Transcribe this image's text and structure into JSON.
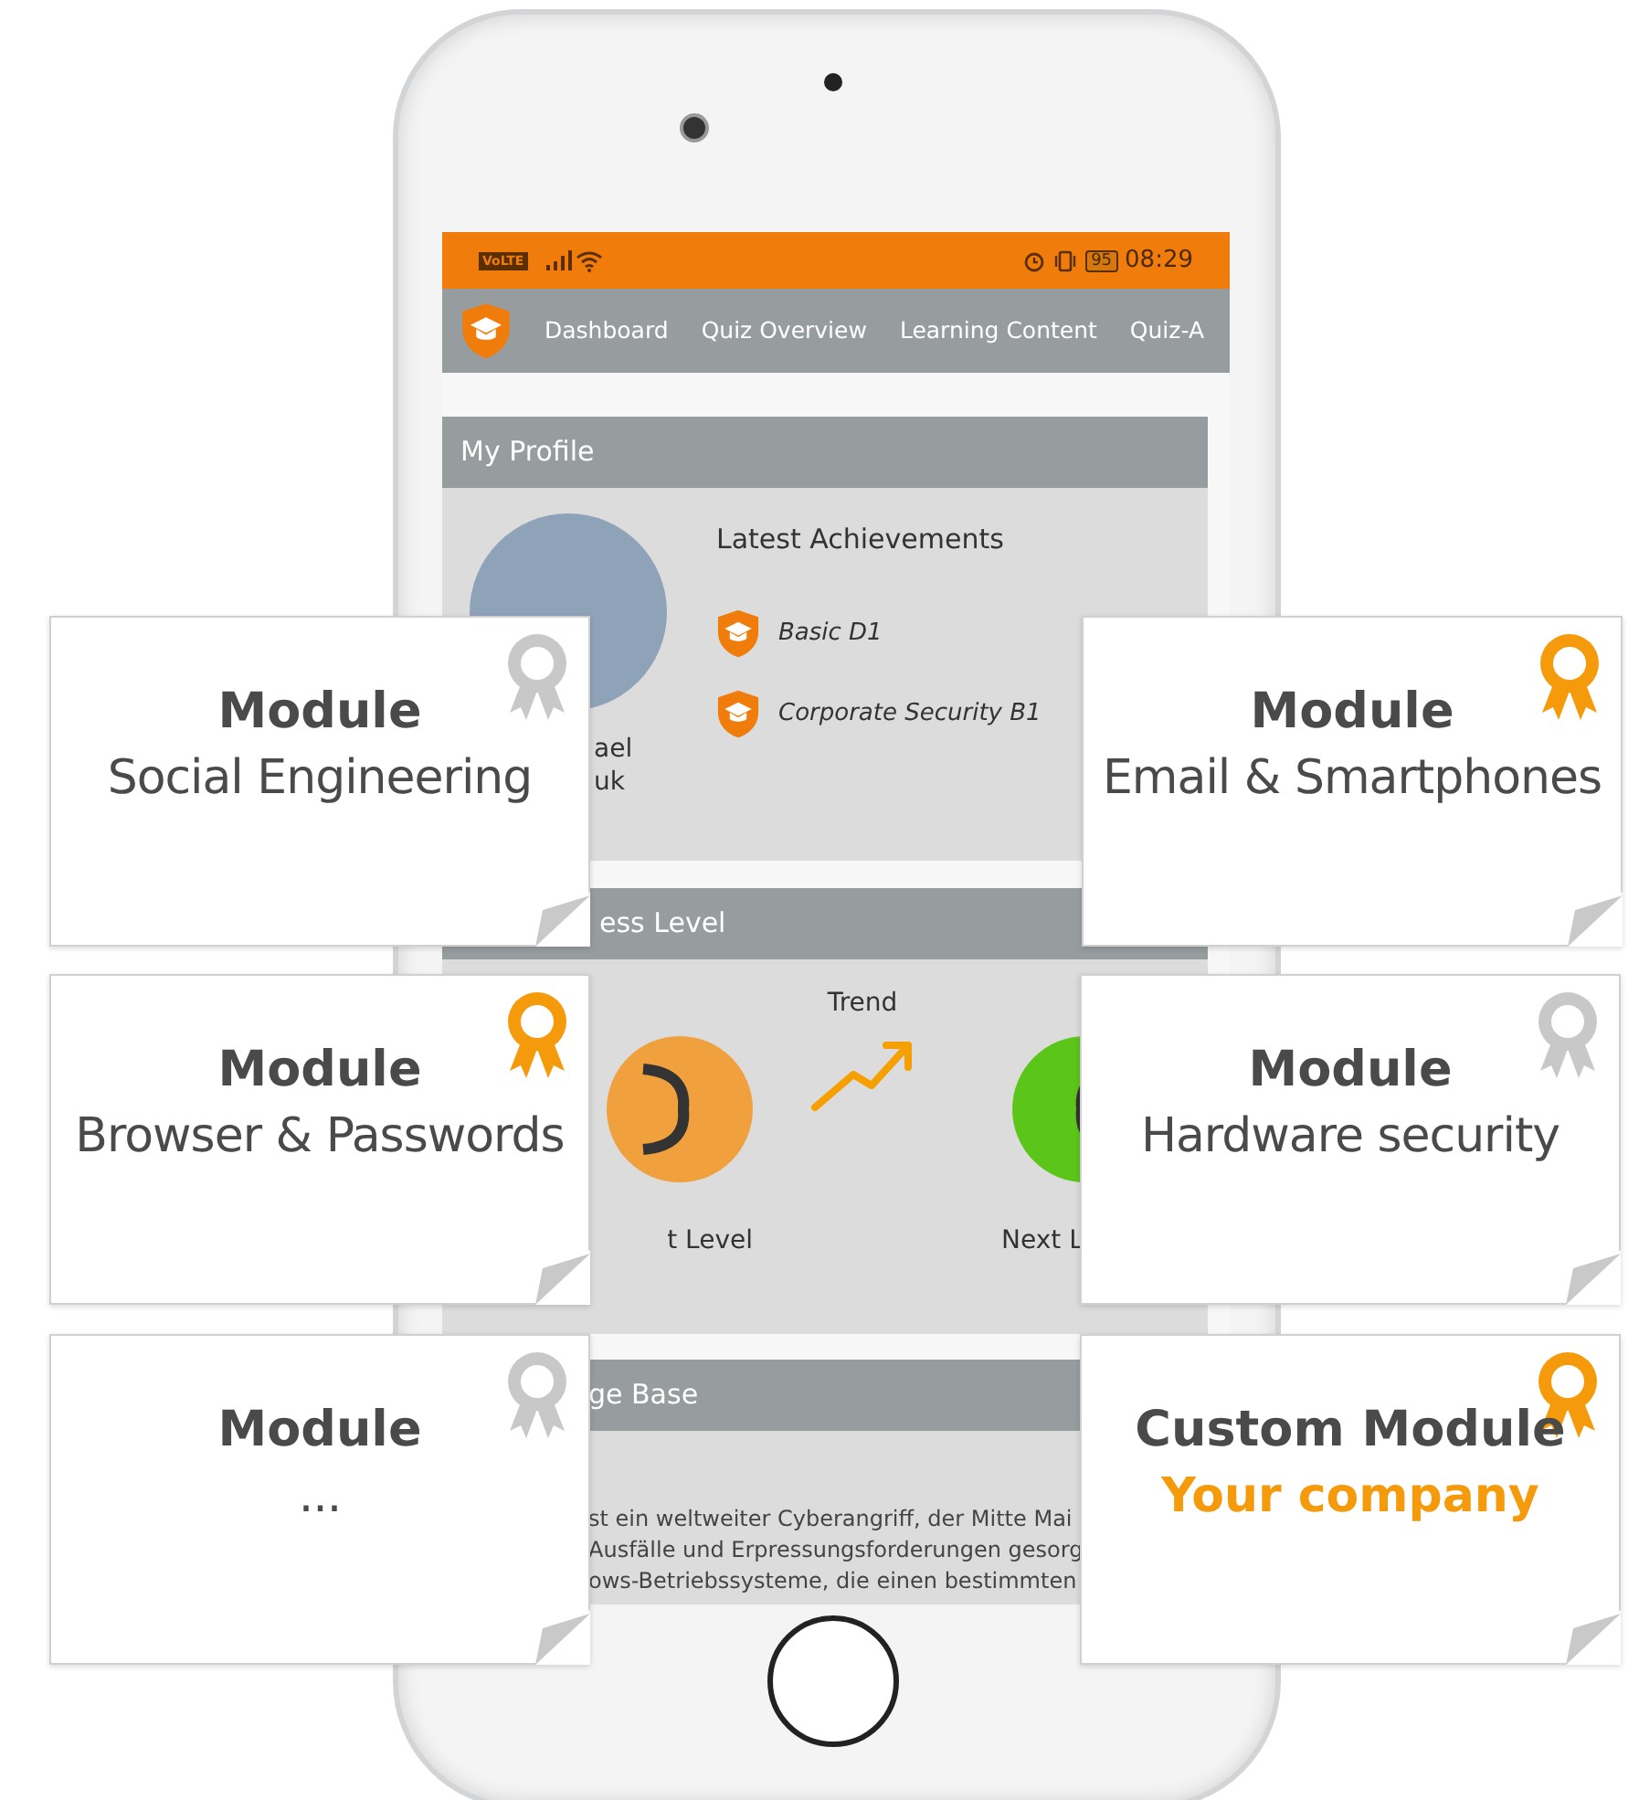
{
  "status_bar": {
    "network": "VoLTE",
    "battery": "95",
    "time": "08:29"
  },
  "nav": {
    "items": [
      "Dashboard",
      "Quiz Overview",
      "Learning Content",
      "Quiz-A"
    ]
  },
  "profile": {
    "title": "My Profile",
    "name_lines": [
      "ael",
      "uk"
    ],
    "achievements_title": "Latest Achievements",
    "achievements": [
      "Basic D1",
      "Corporate Security B1"
    ]
  },
  "fitness": {
    "title": "ess Level",
    "trend_label": "Trend",
    "current_label": "t Level",
    "next_label": "Next L"
  },
  "knowledge": {
    "title": "ge Base",
    "lines": [
      "st ein weltweiter Cyberangriff, der Mitte Mai",
      "Ausfälle und Erpressungsforderungen gesorg",
      "ows-Betriebssysteme, die einen bestimmten"
    ]
  },
  "cards": [
    {
      "kind": "standard",
      "title": "Module",
      "subtitle": "Social Engineering",
      "awarded": false
    },
    {
      "kind": "standard",
      "title": "Module",
      "subtitle": "Email & Smartphones",
      "awarded": true
    },
    {
      "kind": "standard",
      "title": "Module",
      "subtitle": "Browser & Passwords",
      "awarded": true
    },
    {
      "kind": "standard",
      "title": "Module",
      "subtitle": "Hardware security",
      "awarded": false
    },
    {
      "kind": "standard",
      "title": "Module",
      "subtitle": "...",
      "awarded": false
    },
    {
      "kind": "custom",
      "title": "Custom Module",
      "subtitle": "Your company",
      "awarded": true
    }
  ]
}
